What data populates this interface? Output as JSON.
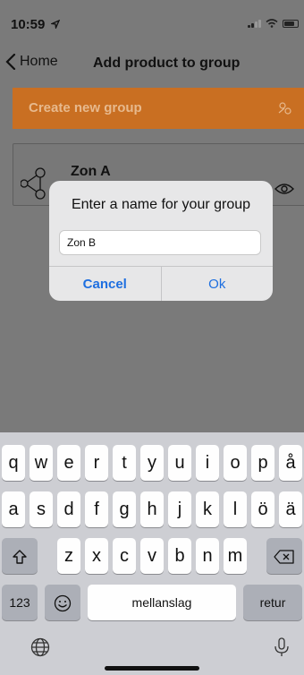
{
  "status_bar": {
    "time": "10:59",
    "location_icon": "location-arrow-icon",
    "icons": [
      "cellular-icon",
      "wifi-icon",
      "battery-icon"
    ]
  },
  "nav": {
    "back_label": "Home",
    "title": "Add product to group"
  },
  "create_group": {
    "label": "Create new group",
    "icon": "group-add-icon",
    "color": "#c96f22"
  },
  "groups": [
    {
      "name": "Zon A",
      "icon": "hub-icon",
      "action_icon": "eye-icon"
    }
  ],
  "dialog": {
    "title": "Enter a name for your group",
    "input_value": "Zon B",
    "cancel_label": "Cancel",
    "ok_label": "Ok"
  },
  "keyboard": {
    "row1": [
      "q",
      "w",
      "e",
      "r",
      "t",
      "y",
      "u",
      "i",
      "o",
      "p",
      "å"
    ],
    "row2": [
      "a",
      "s",
      "d",
      "f",
      "g",
      "h",
      "j",
      "k",
      "l",
      "ö",
      "ä"
    ],
    "row3": [
      "z",
      "x",
      "c",
      "v",
      "b",
      "n",
      "m"
    ],
    "numbers_label": "123",
    "space_label": "mellanslag",
    "return_label": "retur"
  }
}
